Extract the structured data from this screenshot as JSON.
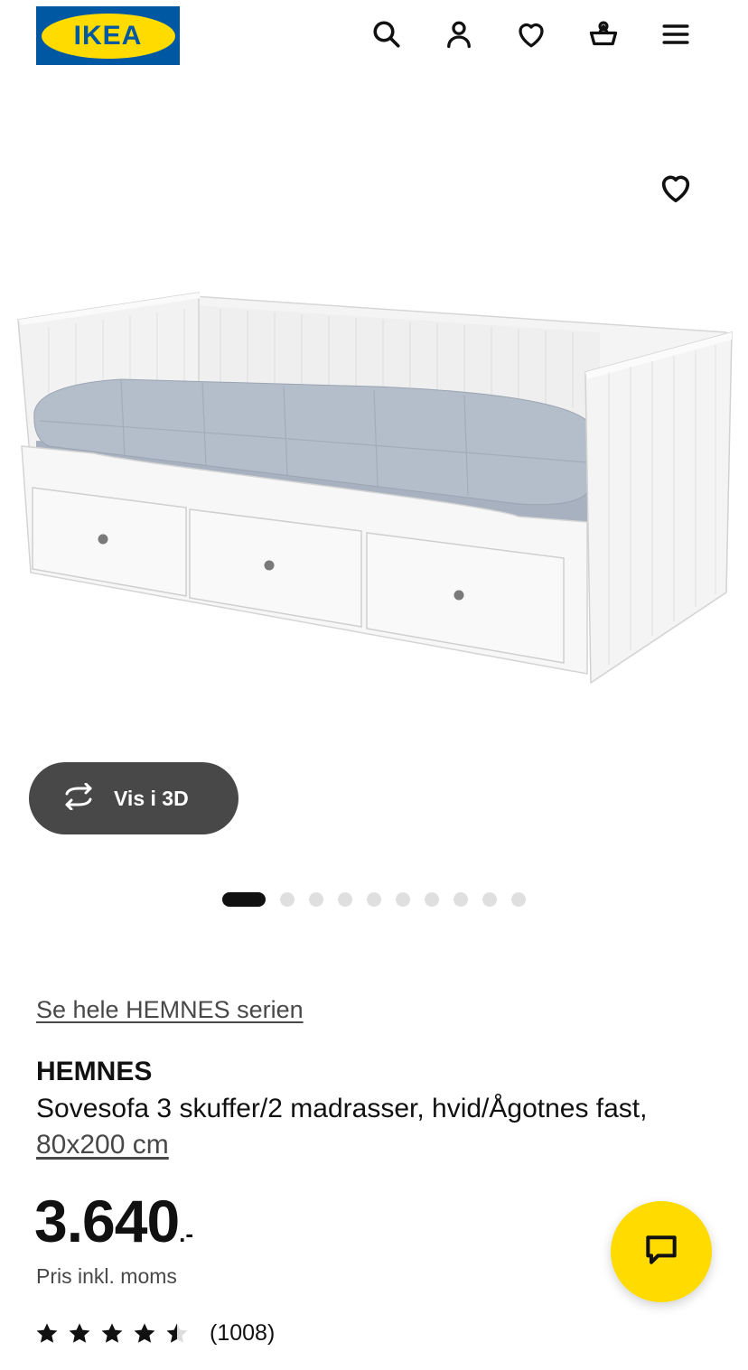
{
  "header": {
    "logo_text": "IKEA",
    "icons": [
      "search-icon",
      "account-icon",
      "favourites-icon",
      "basket-icon",
      "menu-icon"
    ]
  },
  "gallery": {
    "view_3d_label": "Vis i 3D",
    "dot_count": 10,
    "active_index": 0
  },
  "product": {
    "series_link": "Se hele HEMNES serien",
    "name": "HEMNES",
    "description": "Sovesofa 3 skuffer/2 madrasser, hvid/Ågotnes fast,",
    "size_link": "80x200 cm",
    "price_integer": "3.640",
    "price_suffix": ".-",
    "vat_note": "Pris inkl. moms",
    "rating_stars": 4.5,
    "rating_count": "(1008)"
  },
  "colors": {
    "brand_blue": "#0058a3",
    "brand_yellow": "#ffdb00",
    "text_dark": "#111111",
    "text_grey": "#484848"
  }
}
